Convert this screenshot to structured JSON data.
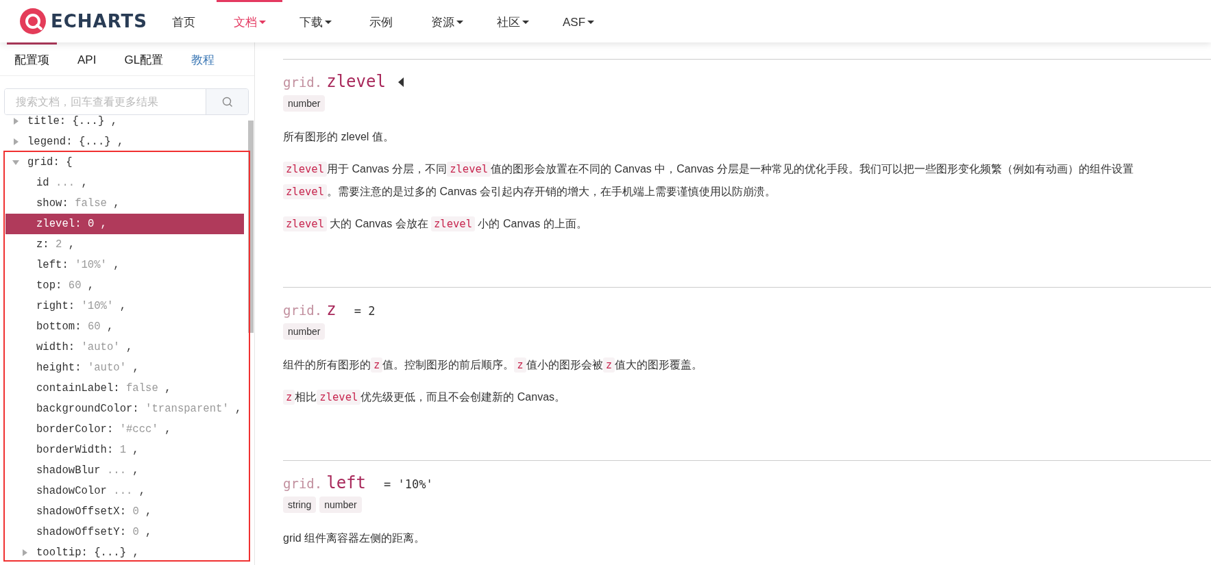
{
  "header": {
    "logo": "ECHARTS",
    "nav": [
      {
        "label": "首页",
        "selected": false,
        "dropdown": false
      },
      {
        "label": "文档",
        "selected": true,
        "dropdown": true
      },
      {
        "label": "下载",
        "selected": false,
        "dropdown": true
      },
      {
        "label": "示例",
        "selected": false,
        "dropdown": false
      },
      {
        "label": "资源",
        "selected": false,
        "dropdown": true
      },
      {
        "label": "社区",
        "selected": false,
        "dropdown": true
      },
      {
        "label": "ASF",
        "selected": false,
        "dropdown": true
      }
    ]
  },
  "sidebar": {
    "tabs": [
      {
        "label": "配置项",
        "selected": true,
        "kind": "tab"
      },
      {
        "label": "API",
        "selected": false,
        "kind": "tab"
      },
      {
        "label": "GL配置",
        "selected": false,
        "kind": "tab"
      },
      {
        "label": "教程",
        "selected": false,
        "kind": "link"
      }
    ],
    "search": {
      "placeholder": "搜索文档，回车查看更多结果"
    },
    "tree": [
      {
        "key": "title:",
        "value": "{...}",
        "end": ",",
        "expanded": false,
        "selected": false
      },
      {
        "key": "legend:",
        "value": "{...}",
        "end": ",",
        "expanded": false,
        "selected": false
      },
      {
        "key": "grid:",
        "value": "{",
        "expanded": true,
        "selected": false,
        "children": [
          {
            "key": "id",
            "value": "...",
            "end": ",",
            "selected": false
          },
          {
            "key": "show:",
            "value": "false",
            "end": ",",
            "selected": false
          },
          {
            "key": "zlevel:",
            "value": "0",
            "end": ",",
            "selected": true
          },
          {
            "key": "z:",
            "value": "2",
            "end": ",",
            "selected": false
          },
          {
            "key": "left:",
            "value": "'10%'",
            "end": ",",
            "selected": false
          },
          {
            "key": "top:",
            "value": "60",
            "end": ",",
            "selected": false
          },
          {
            "key": "right:",
            "value": "'10%'",
            "end": ",",
            "selected": false
          },
          {
            "key": "bottom:",
            "value": "60",
            "end": ",",
            "selected": false
          },
          {
            "key": "width:",
            "value": "'auto'",
            "end": ",",
            "selected": false
          },
          {
            "key": "height:",
            "value": "'auto'",
            "end": ",",
            "selected": false
          },
          {
            "key": "containLabel:",
            "value": "false",
            "end": ",",
            "selected": false
          },
          {
            "key": "backgroundColor:",
            "value": "'transparent'",
            "end": ",",
            "selected": false
          },
          {
            "key": "borderColor:",
            "value": "'#ccc'",
            "end": ",",
            "selected": false
          },
          {
            "key": "borderWidth:",
            "value": "1",
            "end": ",",
            "selected": false
          },
          {
            "key": "shadowBlur",
            "value": "...",
            "end": ",",
            "selected": false
          },
          {
            "key": "shadowColor",
            "value": "...",
            "end": ",",
            "selected": false
          },
          {
            "key": "shadowOffsetX:",
            "value": "0",
            "end": ",",
            "selected": false
          },
          {
            "key": "shadowOffsetY:",
            "value": "0",
            "end": ",",
            "selected": false
          },
          {
            "key": "tooltip:",
            "value": "{...}",
            "end": ",",
            "expanded": false,
            "selected": false
          }
        ]
      }
    ]
  },
  "sections": [
    {
      "prefix": "grid.",
      "name": "zlevel",
      "toggle": true,
      "types": [
        "number"
      ],
      "paragraphs": [
        [
          {
            "kind": "text",
            "text": "所有图形的 zlevel 值。"
          }
        ],
        [
          {
            "kind": "code",
            "text": "zlevel"
          },
          {
            "kind": "text",
            "text": "用于 Canvas 分层，不同"
          },
          {
            "kind": "code",
            "text": "zlevel"
          },
          {
            "kind": "text",
            "text": "值的图形会放置在不同的 Canvas 中，Canvas 分层是一种常见的优化手段。我们可以把一些图形变化频繁（例如有动画）的组件设置"
          },
          {
            "kind": "break"
          },
          {
            "kind": "code",
            "text": "zlevel"
          },
          {
            "kind": "text",
            "text": "。需要注意的是过多的 Canvas 会引起内存开销的增大，在手机端上需要谨慎使用以防崩溃。"
          }
        ],
        [
          {
            "kind": "code",
            "text": "zlevel"
          },
          {
            "kind": "text",
            "text": " 大的 Canvas 会放在 "
          },
          {
            "kind": "code",
            "text": "zlevel"
          },
          {
            "kind": "text",
            "text": " 小的 Canvas 的上面。"
          }
        ]
      ]
    },
    {
      "prefix": "grid.",
      "name": "z",
      "default": "= 2",
      "toggle": false,
      "types": [
        "number"
      ],
      "paragraphs": [
        [
          {
            "kind": "text",
            "text": "组件的所有图形的"
          },
          {
            "kind": "code",
            "text": "z"
          },
          {
            "kind": "text",
            "text": "值。控制图形的前后顺序。"
          },
          {
            "kind": "code",
            "text": "z"
          },
          {
            "kind": "text",
            "text": "值小的图形会被"
          },
          {
            "kind": "code",
            "text": "z"
          },
          {
            "kind": "text",
            "text": "值大的图形覆盖。"
          }
        ],
        [
          {
            "kind": "code",
            "text": "z"
          },
          {
            "kind": "text",
            "text": "相比"
          },
          {
            "kind": "code",
            "text": "zlevel"
          },
          {
            "kind": "text",
            "text": "优先级更低，而且不会创建新的 Canvas。"
          }
        ]
      ]
    },
    {
      "prefix": "grid.",
      "name": "left",
      "default": "= '10%'",
      "toggle": false,
      "types": [
        "string",
        "number"
      ],
      "paragraphs": [
        [
          {
            "kind": "text",
            "text": "grid 组件离容器左侧的距离。"
          }
        ]
      ]
    }
  ]
}
